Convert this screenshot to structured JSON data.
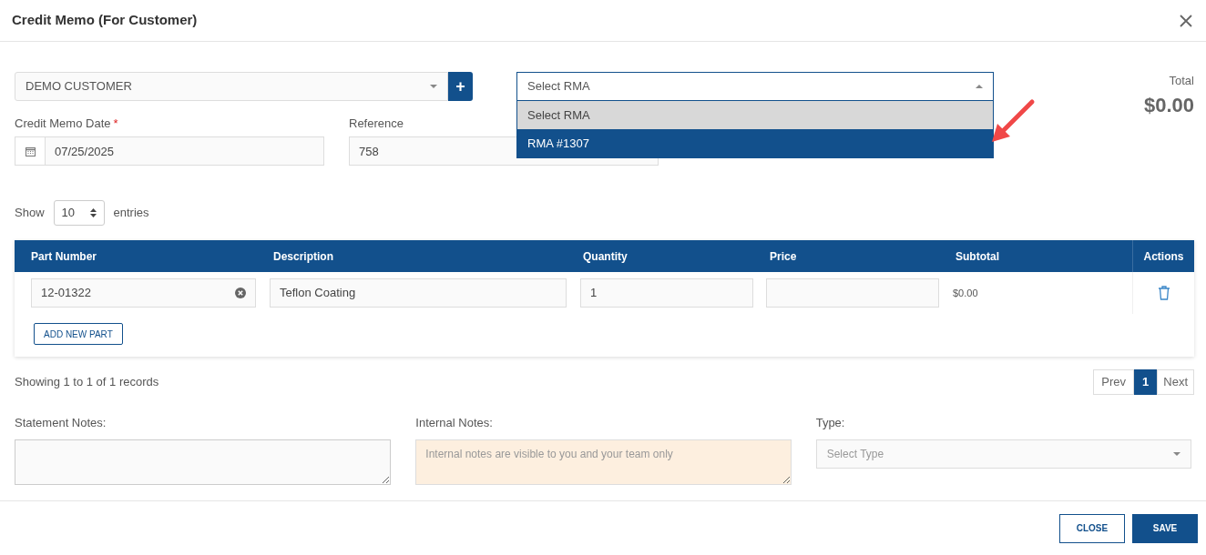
{
  "dialog": {
    "title": "Credit Memo (For Customer)"
  },
  "customer": {
    "value": "DEMO CUSTOMER",
    "add_label": "+"
  },
  "rma": {
    "value": "Select RMA",
    "expanded": true,
    "options": [
      {
        "label": "Select RMA",
        "selected": true,
        "highlighted": false
      },
      {
        "label": "RMA #1307",
        "selected": false,
        "highlighted": true
      }
    ]
  },
  "total": {
    "label": "Total",
    "value": "$0.00"
  },
  "date": {
    "label": "Credit Memo Date",
    "required": true,
    "required_mark": "*",
    "value": "07/25/2025"
  },
  "reference": {
    "label": "Reference",
    "value": "758"
  },
  "entries": {
    "prefix": "Show",
    "value": "10",
    "suffix": "entries"
  },
  "table": {
    "columns": [
      "Part Number",
      "Description",
      "Quantity",
      "Price",
      "Subtotal",
      "Actions"
    ],
    "rows": [
      {
        "part_number": "12-01322",
        "description": "Teflon Coating",
        "quantity": "1",
        "subtotal": "$0.00"
      }
    ],
    "add_label": "ADD NEW PART"
  },
  "records_info": "Showing 1 to 1 of 1 records",
  "pagination": {
    "prev": "Prev",
    "pages": [
      {
        "label": "1",
        "selected": true
      }
    ],
    "next": "Next"
  },
  "notes": {
    "statement": {
      "label": "Statement Notes:"
    },
    "internal": {
      "label": "Internal Notes:",
      "placeholder": "Internal notes are visible to you and your team only"
    },
    "type": {
      "label": "Type:",
      "placeholder": "Select Type"
    }
  },
  "footer_buttons": [
    {
      "label": "CLOSE",
      "kind": "secondary"
    },
    {
      "label": "SAVE",
      "kind": "primary"
    }
  ]
}
